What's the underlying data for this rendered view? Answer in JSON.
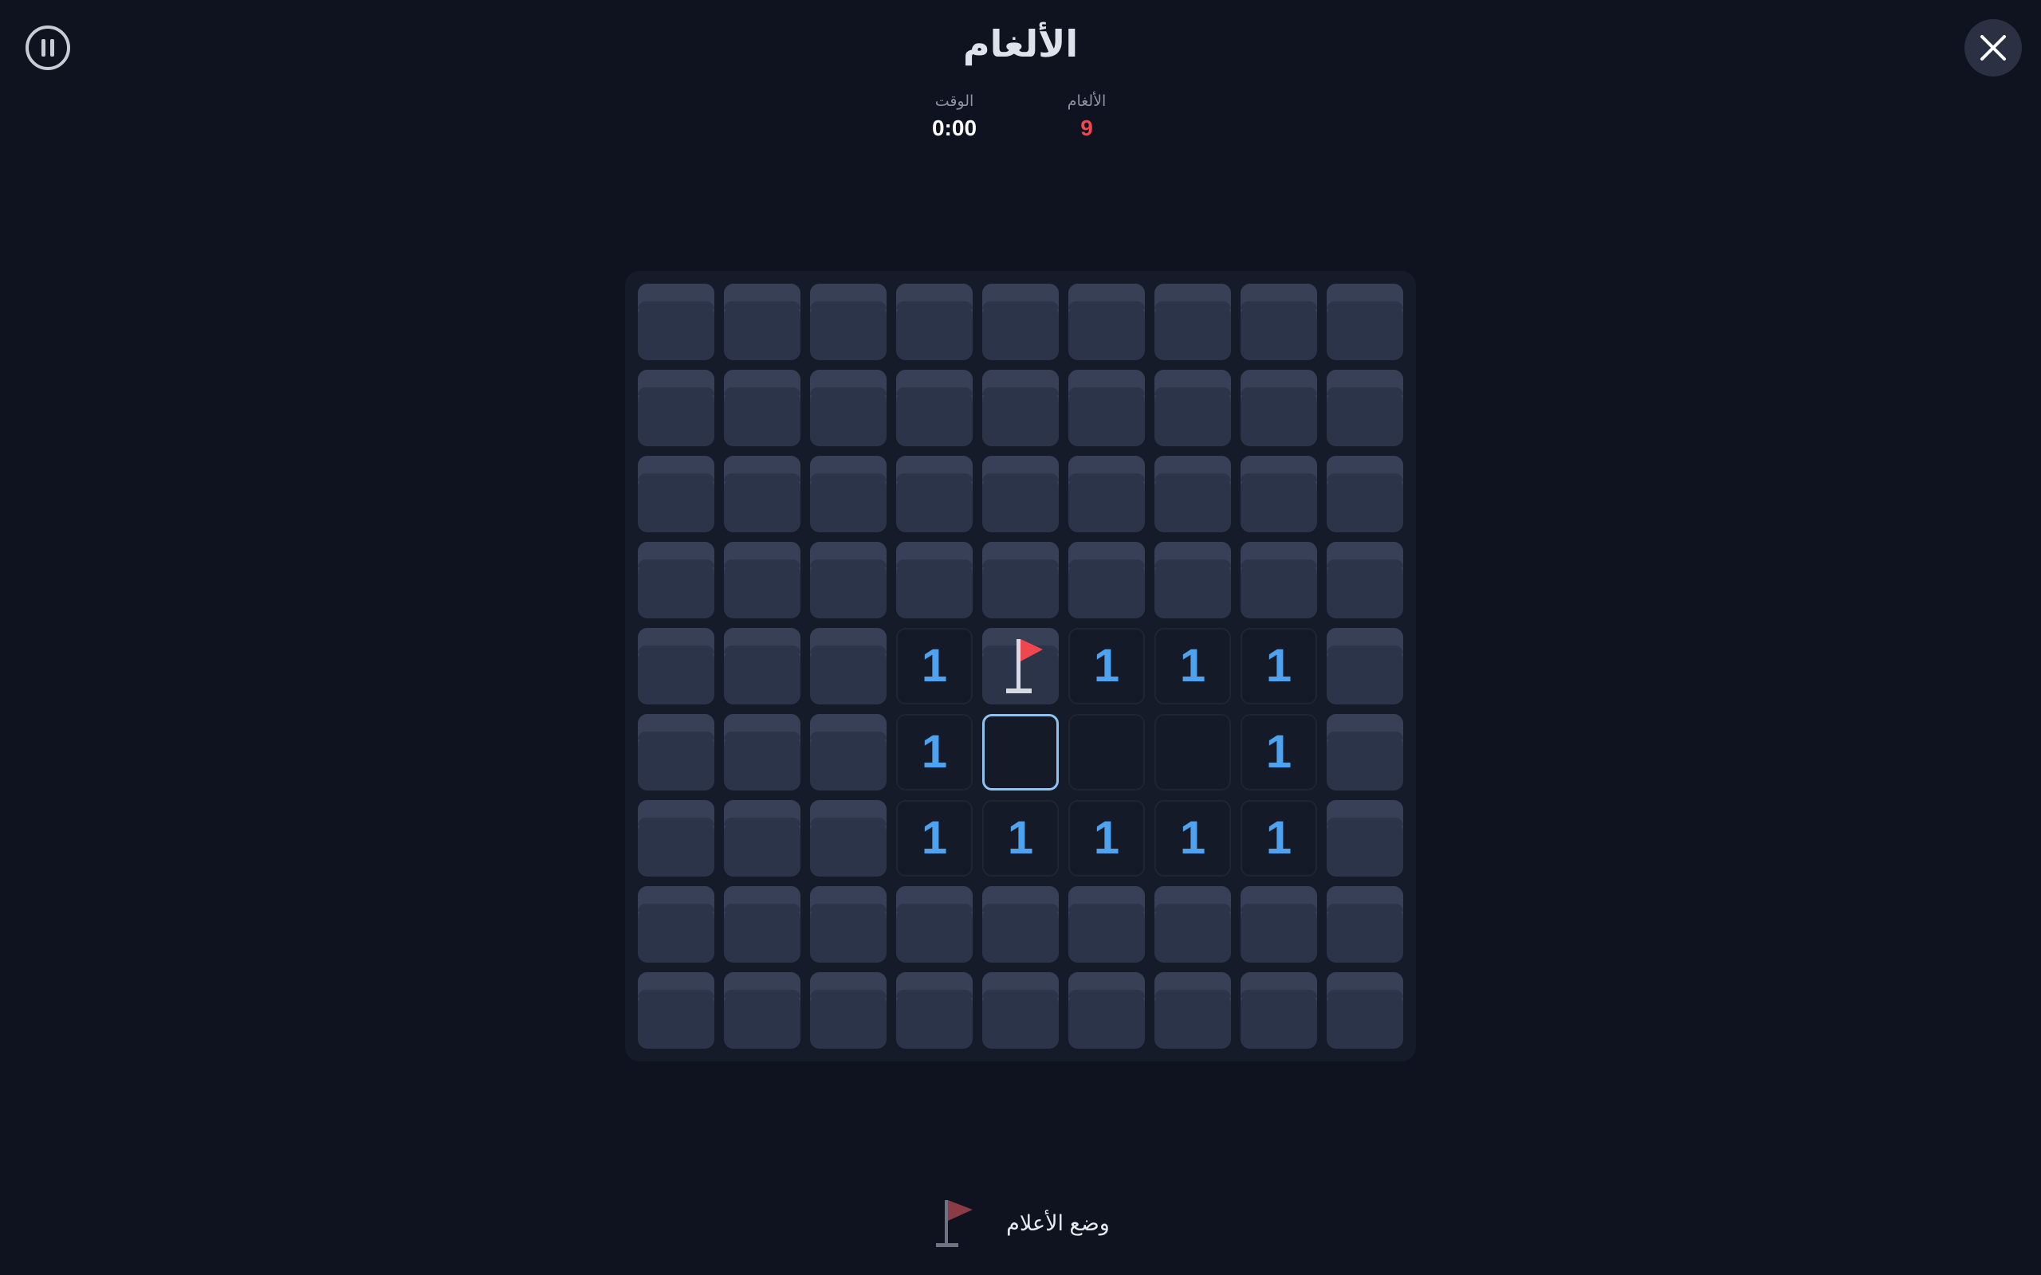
{
  "header": {
    "title": "الألغام"
  },
  "stats": {
    "mines_label": "الألغام",
    "mines_value": "9",
    "time_label": "الوقت",
    "time_value": "0:00"
  },
  "board": {
    "rows": 9,
    "cols": 9,
    "cells": [
      [
        "h",
        "h",
        "h",
        "h",
        "h",
        "h",
        "h",
        "h",
        "h"
      ],
      [
        "h",
        "h",
        "h",
        "h",
        "h",
        "h",
        "h",
        "h",
        "h"
      ],
      [
        "h",
        "h",
        "h",
        "h",
        "h",
        "h",
        "h",
        "h",
        "h"
      ],
      [
        "h",
        "h",
        "h",
        "h",
        "h",
        "h",
        "h",
        "h",
        "h"
      ],
      [
        "h",
        "h",
        "h",
        "1",
        "F",
        "1",
        "1",
        "1",
        "h"
      ],
      [
        "h",
        "h",
        "h",
        "1",
        "0",
        "0",
        "0",
        "1",
        "h"
      ],
      [
        "h",
        "h",
        "h",
        "1",
        "1",
        "1",
        "1",
        "1",
        "h"
      ],
      [
        "h",
        "h",
        "h",
        "h",
        "h",
        "h",
        "h",
        "h",
        "h"
      ],
      [
        "h",
        "h",
        "h",
        "h",
        "h",
        "h",
        "h",
        "h",
        "h"
      ]
    ],
    "selected": {
      "row": 5,
      "col": 4
    }
  },
  "flag_mode": {
    "label": "وضع الأعلام"
  },
  "icons": {
    "pause": "pause-icon",
    "close": "close-icon",
    "flag": "flag-icon"
  },
  "colors": {
    "background": "#0f1320",
    "hidden_cell": "#2c3449",
    "revealed_cell": "#151a28",
    "number": "#4da3f0",
    "mines_count": "#f0474f",
    "flag": "#f0474f",
    "selected_border": "#8ec3f2"
  }
}
